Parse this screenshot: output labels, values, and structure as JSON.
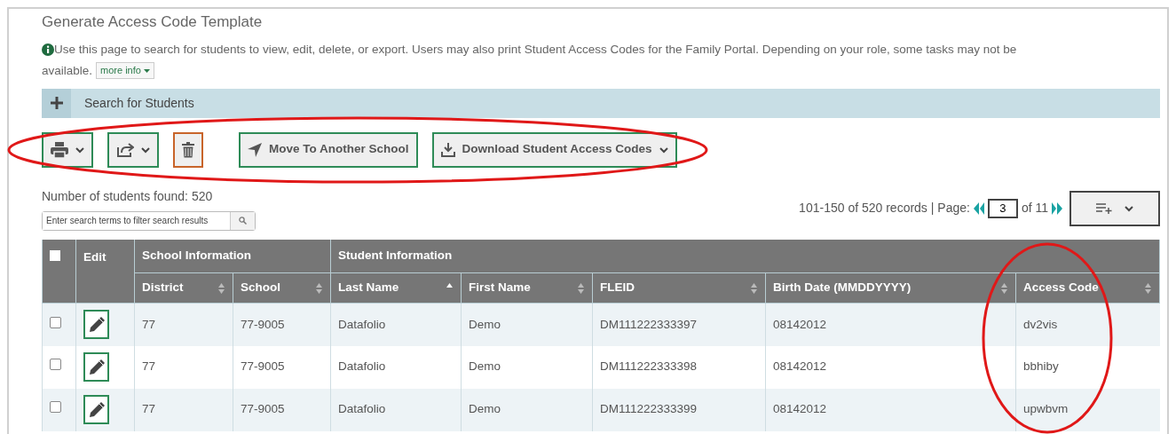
{
  "title": "Generate Access Code Template",
  "info": {
    "lines": [
      "Use this page to search for students to view, edit, delete, or export. Users may also print Student Access Codes for the Family Portal. Depending on your role, some tasks may not be",
      "available."
    ],
    "more_info": "more info"
  },
  "search_panel": {
    "label": "Search for Students",
    "expanded": false
  },
  "toolbar": [
    {
      "kind": "print"
    },
    {
      "kind": "export"
    },
    {
      "kind": "delete"
    },
    {
      "kind": "move",
      "label": "Move To Another School"
    },
    {
      "kind": "download",
      "label": "Download Student Access Codes"
    }
  ],
  "count_text": "Number of students found: 520",
  "filter": {
    "placeholder": "Enter search terms to filter search results"
  },
  "pagination": {
    "range": "101-150 of 520 records | Page:",
    "page": "3",
    "of": "of 11"
  },
  "table": {
    "group_headers": [
      {
        "label": "Edit"
      },
      {
        "label": "School Information"
      },
      {
        "label": "Student Information"
      }
    ],
    "all_selected": false,
    "columns": [
      {
        "label": "District",
        "sorted_ascending": false
      },
      {
        "label": "School",
        "sorted_ascending": false
      },
      {
        "label": "Last Name",
        "sorted_ascending": true
      },
      {
        "label": "First Name",
        "sorted_ascending": false
      },
      {
        "label": "FLEID",
        "sorted_ascending": false
      },
      {
        "label": "Birth Date (MMDDYYYY)",
        "sorted_ascending": false
      },
      {
        "label": "Access Code",
        "sorted_ascending": false
      }
    ],
    "rows": [
      {
        "selected": false,
        "cells": [
          "77",
          "77-9005",
          "Datafolio",
          "Demo",
          "DM111222333397",
          "08142012",
          "dv2vis"
        ]
      },
      {
        "selected": false,
        "cells": [
          "77",
          "77-9005",
          "Datafolio",
          "Demo",
          "DM111222333398",
          "08142012",
          "bbhiby"
        ]
      },
      {
        "selected": false,
        "cells": [
          "77",
          "77-9005",
          "Datafolio",
          "Demo",
          "DM111222333399",
          "08142012",
          "upwbvm"
        ]
      }
    ]
  },
  "annotations": [
    {
      "kind": "ellipse"
    },
    {
      "kind": "ellipse"
    }
  ]
}
